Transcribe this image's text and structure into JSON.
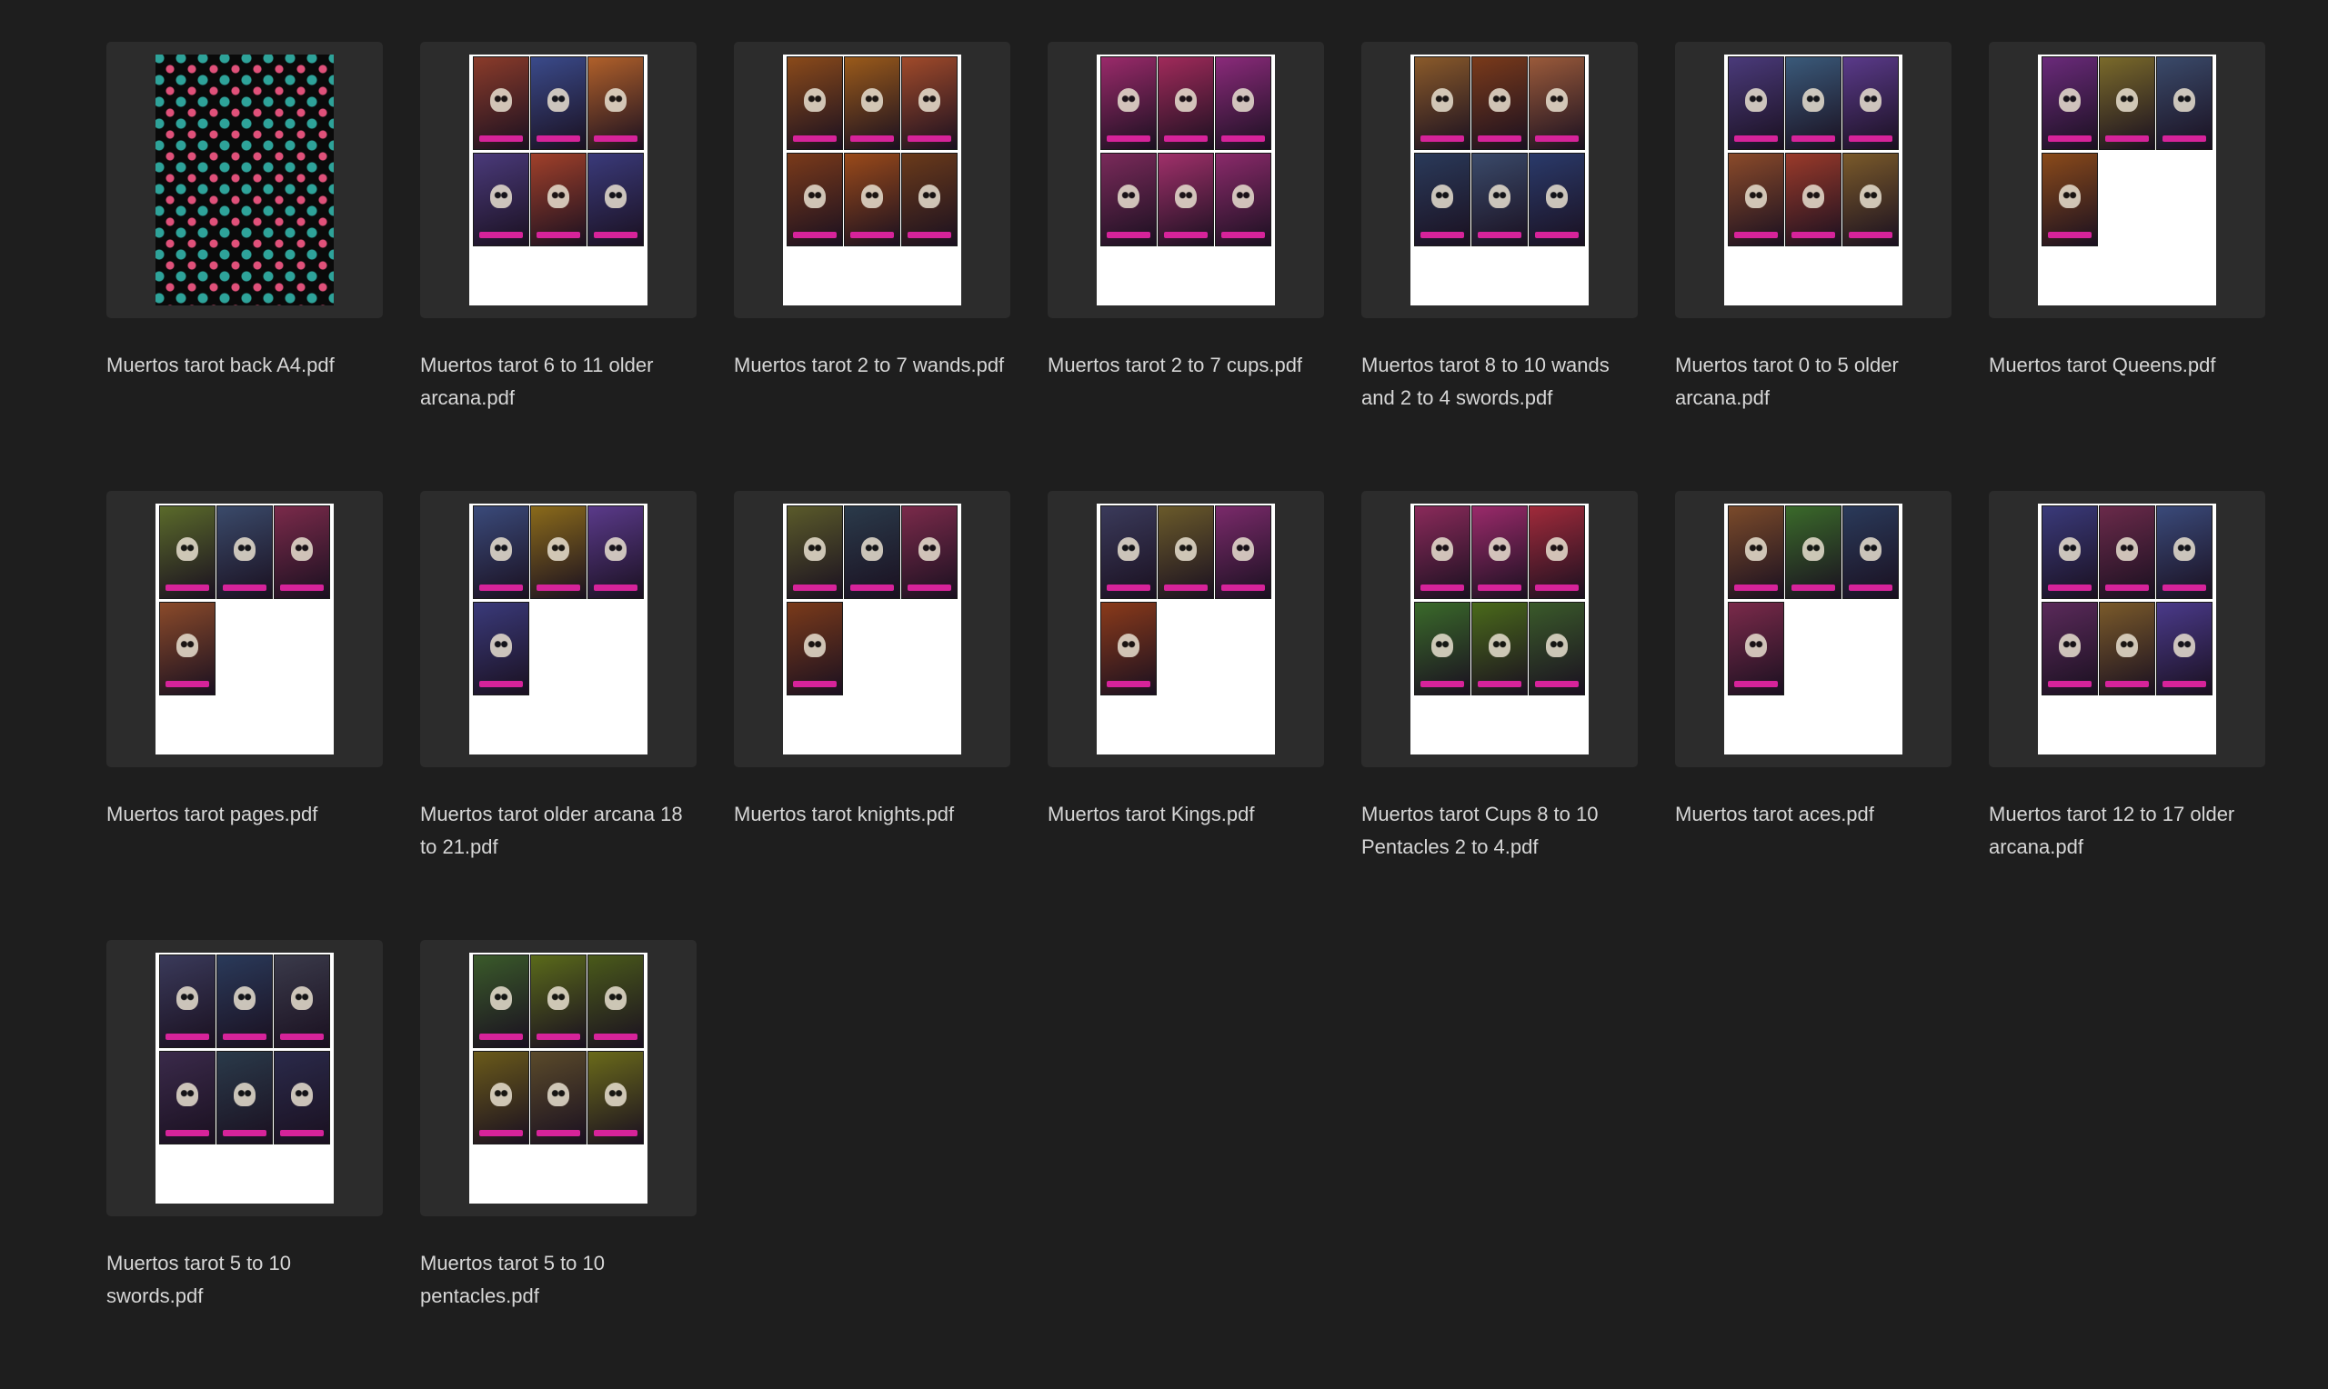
{
  "files": [
    {
      "name": "Muertos tarot back A4.pdf",
      "cards": 0,
      "pattern": true,
      "colors": []
    },
    {
      "name": "Muertos tarot 6 to 11 older arcana.pdf",
      "cards": 6,
      "pattern": false,
      "colors": [
        "#8a3b2a",
        "#3a4a8a",
        "#b0602a",
        "#4a3a7a",
        "#a0402a",
        "#3a3a7a"
      ]
    },
    {
      "name": "Muertos tarot 2 to 7 wands.pdf",
      "cards": 6,
      "pattern": false,
      "colors": [
        "#8a4a1a",
        "#9a5a1a",
        "#a04a2a",
        "#7a3a1a",
        "#9a4a1a",
        "#6a3a1a"
      ]
    },
    {
      "name": "Muertos tarot 2 to 7 cups.pdf",
      "cards": 6,
      "pattern": false,
      "colors": [
        "#9a2a6a",
        "#a02a5a",
        "#8a2a7a",
        "#7a2a5a",
        "#a0306a",
        "#8a2a6a"
      ]
    },
    {
      "name": "Muertos tarot 8 to 10 wands and 2 to 4 swords.pdf",
      "cards": 6,
      "pattern": false,
      "colors": [
        "#8a5a2a",
        "#7a3a1a",
        "#9a5a3a",
        "#2a3a5a",
        "#3a4a6a",
        "#2a3a6a"
      ]
    },
    {
      "name": "Muertos tarot 0 to 5 older arcana.pdf",
      "cards": 6,
      "pattern": false,
      "colors": [
        "#4a3a7a",
        "#3a5a7a",
        "#5a3a8a",
        "#8a4a2a",
        "#9a3a2a",
        "#7a5a2a"
      ]
    },
    {
      "name": "Muertos tarot Queens.pdf",
      "cards": 4,
      "pattern": false,
      "colors": [
        "#6a2a7a",
        "#7a6a2a",
        "#3a4a6a",
        "#8a4a1a"
      ]
    },
    {
      "name": "Muertos tarot pages.pdf",
      "cards": 4,
      "pattern": false,
      "colors": [
        "#5a6a2a",
        "#3a4a6a",
        "#7a2a4a",
        "#8a4a2a"
      ]
    },
    {
      "name": "Muertos tarot older arcana 18 to 21.pdf",
      "cards": 4,
      "pattern": false,
      "colors": [
        "#3a4a7a",
        "#8a6a1a",
        "#5a3a8a",
        "#3a3a7a"
      ]
    },
    {
      "name": "Muertos tarot knights.pdf",
      "cards": 4,
      "pattern": false,
      "colors": [
        "#5a5a2a",
        "#2a3a4a",
        "#7a2a4a",
        "#7a3a1a"
      ]
    },
    {
      "name": "Muertos tarot Kings.pdf",
      "cards": 4,
      "pattern": false,
      "colors": [
        "#3a3a5a",
        "#6a5a2a",
        "#7a2a6a",
        "#8a3a1a"
      ]
    },
    {
      "name": "Muertos tarot Cups 8 to 10 Pentacles 2 to 4.pdf",
      "cards": 6,
      "pattern": false,
      "colors": [
        "#8a2a5a",
        "#9a2a6a",
        "#a02a3a",
        "#3a6a2a",
        "#4a6a1a",
        "#3a5a2a"
      ]
    },
    {
      "name": "Muertos tarot aces.pdf",
      "cards": 4,
      "pattern": false,
      "colors": [
        "#7a4a2a",
        "#3a6a2a",
        "#2a3a5a",
        "#7a2a4a"
      ]
    },
    {
      "name": "Muertos tarot 12 to 17 older arcana.pdf",
      "cards": 6,
      "pattern": false,
      "colors": [
        "#3a3a7a",
        "#6a2a4a",
        "#3a4a7a",
        "#5a2a5a",
        "#7a5a2a",
        "#4a3a8a"
      ]
    },
    {
      "name": "Muertos tarot 5 to 10 swords.pdf",
      "cards": 6,
      "pattern": false,
      "colors": [
        "#3a3a5a",
        "#2a3a5a",
        "#3a3a4a",
        "#3a2a4a",
        "#2a3a4a",
        "#2a2a4a"
      ]
    },
    {
      "name": "Muertos tarot 5 to 10 pentacles.pdf",
      "cards": 6,
      "pattern": false,
      "colors": [
        "#3a5a2a",
        "#5a6a1a",
        "#4a5a1a",
        "#6a5a1a",
        "#5a4a2a",
        "#6a6a1a"
      ]
    }
  ]
}
